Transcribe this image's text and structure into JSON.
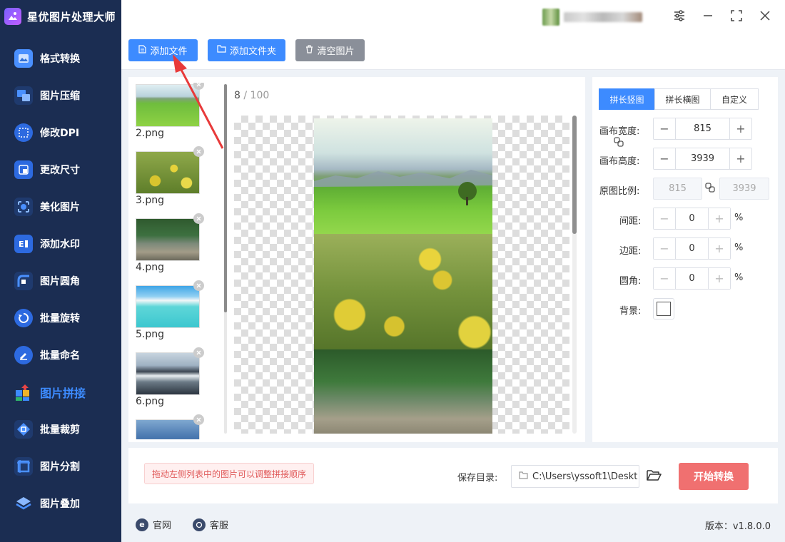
{
  "app": {
    "title": "星优图片处理大师"
  },
  "sidebar": {
    "items": [
      {
        "label": "格式转换",
        "icon": "image-convert-icon"
      },
      {
        "label": "图片压缩",
        "icon": "compress-icon"
      },
      {
        "label": "修改DPI",
        "icon": "dpi-icon"
      },
      {
        "label": "更改尺寸",
        "icon": "resize-icon"
      },
      {
        "label": "美化图片",
        "icon": "beautify-icon"
      },
      {
        "label": "添加水印",
        "icon": "watermark-icon"
      },
      {
        "label": "图片圆角",
        "icon": "round-corner-icon"
      },
      {
        "label": "批量旋转",
        "icon": "rotate-icon"
      },
      {
        "label": "批量命名",
        "icon": "rename-icon"
      },
      {
        "label": "图片拼接",
        "icon": "stitch-icon",
        "active": true
      },
      {
        "label": "批量裁剪",
        "icon": "crop-icon"
      },
      {
        "label": "图片分割",
        "icon": "split-icon"
      },
      {
        "label": "图片叠加",
        "icon": "overlay-icon"
      }
    ]
  },
  "toolbar": {
    "add_file": "添加文件",
    "add_folder": "添加文件夹",
    "clear_images": "清空图片"
  },
  "thumbnails": [
    {
      "name": "2.png",
      "scene": "meadow"
    },
    {
      "name": "3.png",
      "scene": "flowers"
    },
    {
      "name": "4.png",
      "scene": "forest-river"
    },
    {
      "name": "5.png",
      "scene": "beach"
    },
    {
      "name": "6.png",
      "scene": "mountain-lake"
    },
    {
      "name": "",
      "scene": "mountains"
    }
  ],
  "preview": {
    "current": "8",
    "separator": " / ",
    "total": "100"
  },
  "settings": {
    "modes": [
      "拼长竖图",
      "拼长横图",
      "自定义"
    ],
    "active_mode": "拼长竖图",
    "canvas_width_label": "画布宽度:",
    "canvas_width": "815",
    "canvas_height_label": "画布高度:",
    "canvas_height": "3939",
    "ratio_label": "原图比例:",
    "ratio_width": "815",
    "ratio_height": "3939",
    "spacing_label": "间距:",
    "spacing": "0",
    "margin_label": "边距:",
    "margin": "0",
    "corner_label": "圆角:",
    "corner": "0",
    "percent": "%",
    "background_label": "背景:"
  },
  "bottom": {
    "hint": "拖动左侧列表中的图片可以调整拼接顺序",
    "save_label": "保存目录:",
    "save_path": "C:\\Users\\yssoft1\\Deskt",
    "start": "开始转换"
  },
  "footer": {
    "website": "官网",
    "support": "客服",
    "version": "版本：v1.8.0.0"
  },
  "colors": {
    "sidebar_bg": "#1b2d52",
    "accent": "#3d8bff",
    "start_button": "#f07070",
    "clear_button": "#8a8f99"
  }
}
